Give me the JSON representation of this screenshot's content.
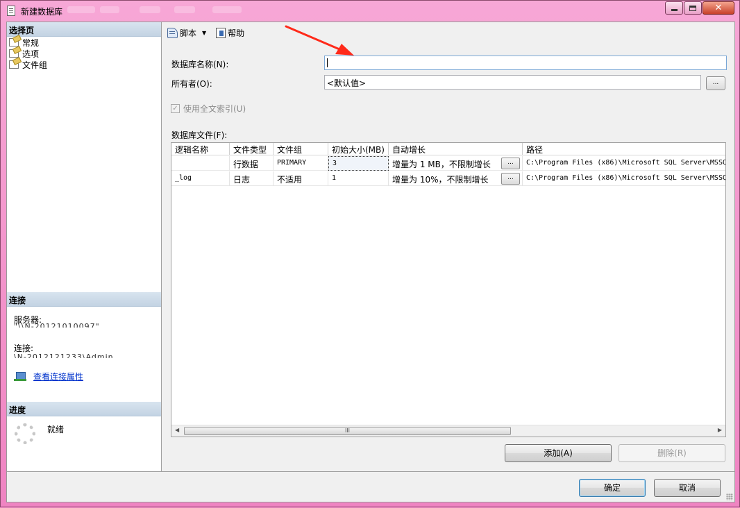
{
  "window": {
    "title": "新建数据库",
    "minimize_icon": "minimize-icon",
    "maximize_icon": "maximize-icon",
    "close_symbol": "✕"
  },
  "left_panel": {
    "select_page_header": "选择页",
    "pages": [
      {
        "label": "常规",
        "icon": "page-icon"
      },
      {
        "label": "选项",
        "icon": "page-icon"
      },
      {
        "label": "文件组",
        "icon": "page-icon"
      }
    ],
    "connection_header": "连接",
    "server_label": "服务器:",
    "server_value": "\"\\\\N-20121010097\"",
    "connection_label": "连接:",
    "connection_value": "\\N-2012121233\\Admin",
    "view_connection_link": "查看连接属性",
    "progress_header": "进度",
    "progress_status": "就绪"
  },
  "toolbar": {
    "script_label": "脚本",
    "help_label": "帮助"
  },
  "form": {
    "db_name_label": "数据库名称(N):",
    "db_name_value": "",
    "owner_label": "所有者(O):",
    "owner_value": "<默认值>",
    "browse_label": "...",
    "fulltext_label": "使用全文索引(U)",
    "fulltext_checked": true,
    "files_label": "数据库文件(F):"
  },
  "grid": {
    "columns": [
      "逻辑名称",
      "文件类型",
      "文件组",
      "初始大小(MB)",
      "自动增长",
      "路径"
    ],
    "rows": [
      {
        "logical_name": "",
        "file_type": "行数据",
        "filegroup": "PRIMARY",
        "initial_size": "3",
        "autogrowth": "增量为 1 MB，不限制增长",
        "browse": "...",
        "path": "C:\\Program Files (x86)\\Microsoft SQL Server\\MSSQ"
      },
      {
        "logical_name": "_log",
        "file_type": "日志",
        "filegroup": "不适用",
        "initial_size": "1",
        "autogrowth": "增量为 10%，不限制增长",
        "browse": "...",
        "path": "C:\\Program Files (x86)\\Microsoft SQL Server\\MSSQ"
      }
    ],
    "scroll_grip": "III"
  },
  "buttons": {
    "add": "添加(A)",
    "remove": "删除(R)",
    "ok": "确定",
    "cancel": "取消"
  },
  "colors": {
    "title_bar": "#f08cc6",
    "annotation_arrow": "#ff2a1a",
    "link": "#0033cc"
  }
}
